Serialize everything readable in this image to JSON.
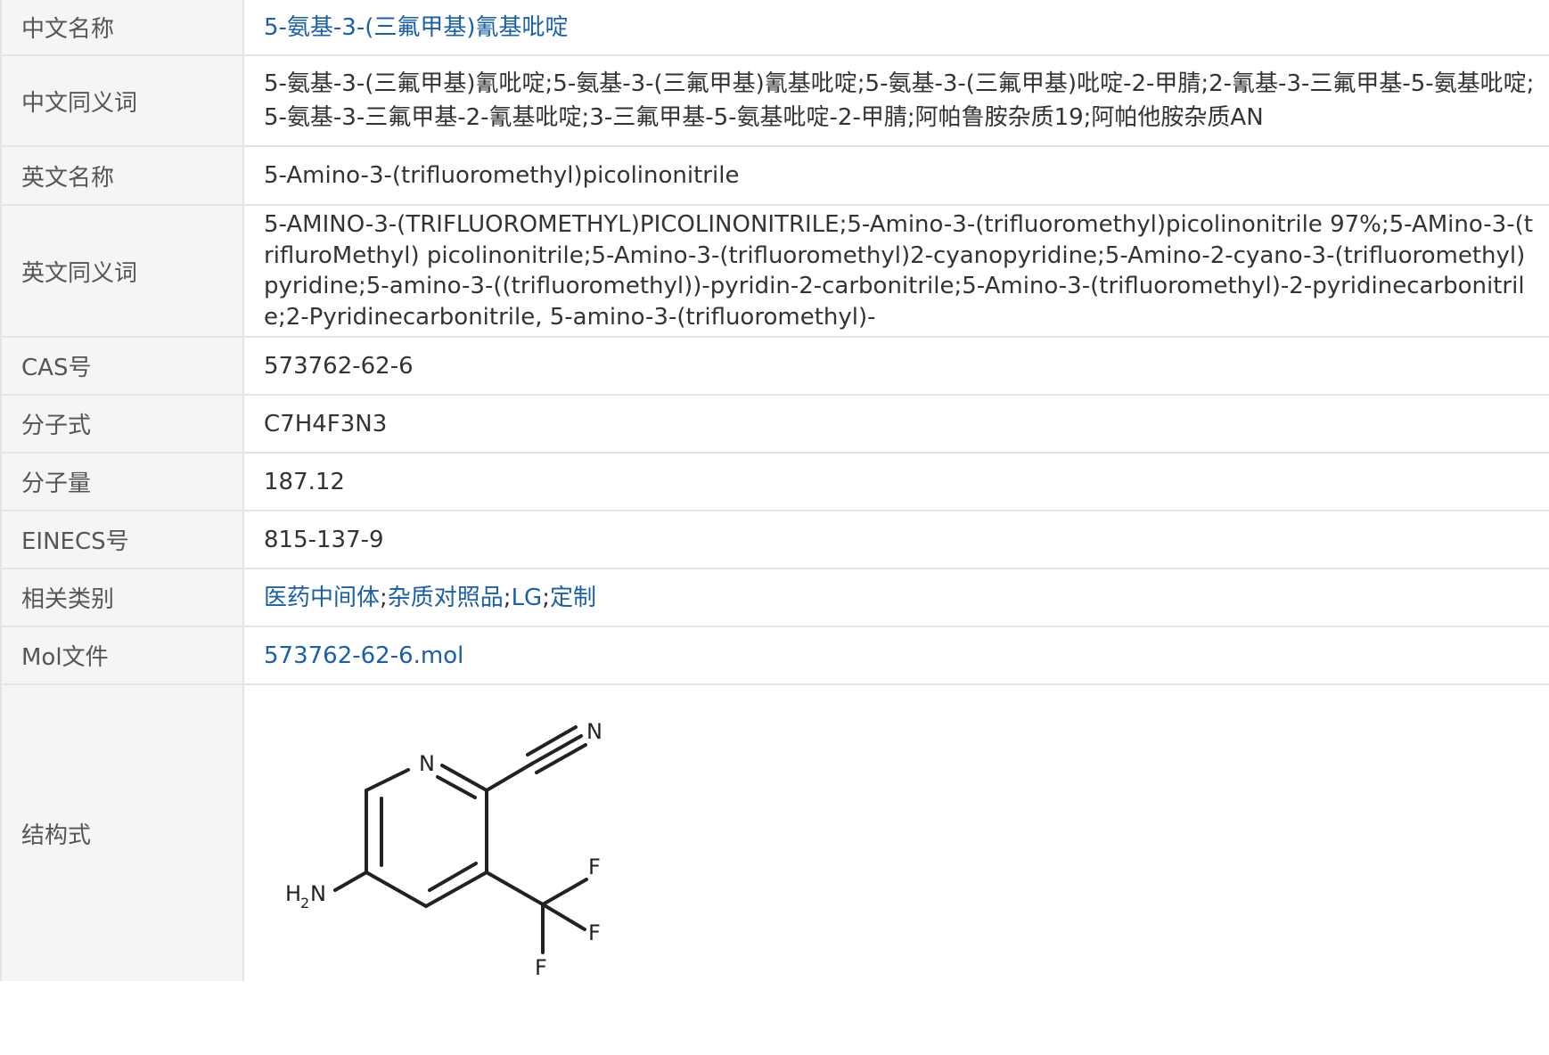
{
  "rows": {
    "cn_name": {
      "label": "中文名称",
      "value": "5-氨基-3-(三氟甲基)氰基吡啶"
    },
    "cn_synonyms": {
      "label": "中文同义词",
      "value": "5-氨基-3-(三氟甲基)氰吡啶;5-氨基-3-(三氟甲基)氰基吡啶;5-氨基-3-(三氟甲基)吡啶-2-甲腈;2-氰基-3-三氟甲基-5-氨基吡啶;5-氨基-3-三氟甲基-2-氰基吡啶;3-三氟甲基-5-氨基吡啶-2-甲腈;阿帕鲁胺杂质19;阿帕他胺杂质AN"
    },
    "en_name": {
      "label": "英文名称",
      "value": "5-Amino-3-(trifluoromethyl)picolinonitrile"
    },
    "en_synonyms": {
      "label": "英文同义词",
      "value": "5-AMINO-3-(TRIFLUOROMETHYL)PICOLINONITRILE;5-Amino-3-(trifluoromethyl)picolinonitrile 97%;5-AMino-3-(trifluroMethyl) picolinonitrile;5-Amino-3-(trifluoromethyl)2-cyanopyridine;5-Amino-2-cyano-3-(trifluoromethyl)pyridine;5-amino-3-((trifluoromethyl))-pyridin-2-carbonitrile;5-Amino-3-(trifluoromethyl)-2-pyridinecarbonitrile;2-Pyridinecarbonitrile, 5-amino-3-(trifluoromethyl)-"
    },
    "cas": {
      "label": "CAS号",
      "value": "573762-62-6"
    },
    "formula": {
      "label": "分子式",
      "value": "C7H4F3N3"
    },
    "weight": {
      "label": "分子量",
      "value": "187.12"
    },
    "einecs": {
      "label": "EINECS号",
      "value": "815-137-9"
    },
    "categories": {
      "label": "相关类别",
      "links": [
        "医药中间体",
        "杂质对照品",
        "LG",
        "定制"
      ],
      "separator": ";"
    },
    "mol_file": {
      "label": "Mol文件",
      "value": "573762-62-6.mol"
    },
    "structure": {
      "label": "结构式",
      "atoms": {
        "n_ring": "N",
        "n_nitrile": "N",
        "nh2_h": "H",
        "nh2_sub": "2",
        "nh2_n": "N",
        "f1": "F",
        "f2": "F",
        "f3": "F"
      }
    }
  },
  "colors": {
    "link": "#1a5fa8",
    "label_bg": "#f5f5f5",
    "border": "#e4e4e4"
  }
}
